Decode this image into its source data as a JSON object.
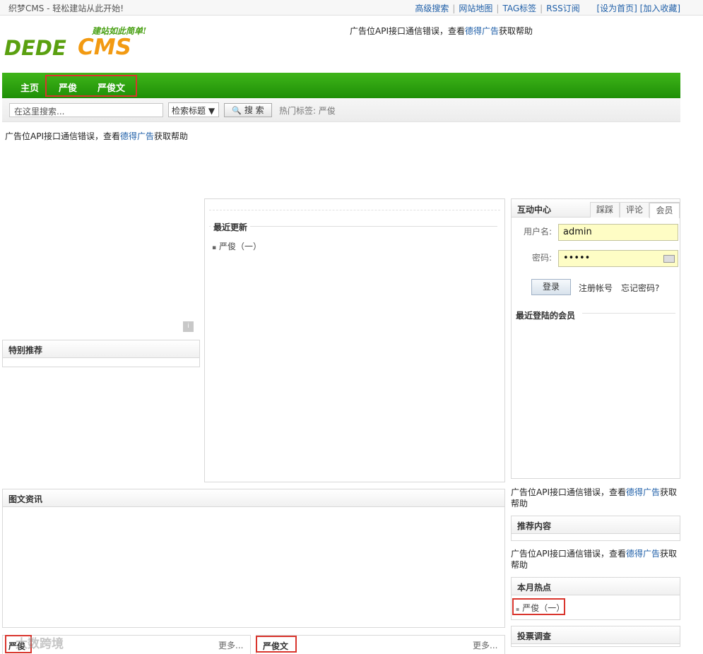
{
  "topbar": {
    "slogan": "织梦CMS - 轻松建站从此开始!",
    "links": [
      "高级搜索",
      "网站地图",
      "TAG标签",
      "RSS订阅"
    ],
    "bracket_links": "[设为首页] [加入收藏]"
  },
  "logo": {
    "tagline": "建站如此简单!",
    "part1": "DEDE",
    "part2": "CMS"
  },
  "ad": {
    "prefix": "广告位API接口通信错误，查看",
    "link": "德得广告",
    "suffix": "获取帮助"
  },
  "nav": {
    "items": [
      "主页",
      "严俊",
      "严俊文"
    ]
  },
  "search": {
    "placeholder": "在这里搜索...",
    "select_value": "检索标题 ▼",
    "button_label": "搜 索",
    "hot_tags": "热门标签: 严俊"
  },
  "left": {
    "special_title": "特别推荐",
    "scroll_glyph": "i"
  },
  "center": {
    "recent_title": "最近更新",
    "items": [
      "严俊（一）"
    ]
  },
  "member": {
    "title": "互动中心",
    "tabs": [
      "踩踩",
      "评论",
      "会员"
    ],
    "username_label": "用户名:",
    "username_value": "admin",
    "password_label": "密码:",
    "password_value": "•••••",
    "login_button": "登录",
    "register_link": "注册帐号",
    "forgot_link": "忘记密码?",
    "recent_members_title": "最近登陆的会员"
  },
  "sidebar": {
    "ad_line1_prefix": "广告位API接口通信错误，查看",
    "ad_line1_link": "德得广告",
    "ad_line1_suffix_a": "获取",
    "ad_line1_suffix_b": "帮助",
    "recommended_title": "推荐内容",
    "hot_month_title": "本月热点",
    "hot_items": [
      "严俊（一）"
    ],
    "vote_title": "投票调查"
  },
  "bottom": {
    "picnews_title": "图文资讯",
    "block1_title": "严俊",
    "block2_title": "严俊文",
    "more_label": "更多..."
  },
  "watermark": "大数跨境",
  "colors": {
    "nav_green": "#2ca010",
    "highlight_red": "#d9352d",
    "input_yellow": "#fefdc5",
    "link_blue": "#1f5fa8"
  }
}
